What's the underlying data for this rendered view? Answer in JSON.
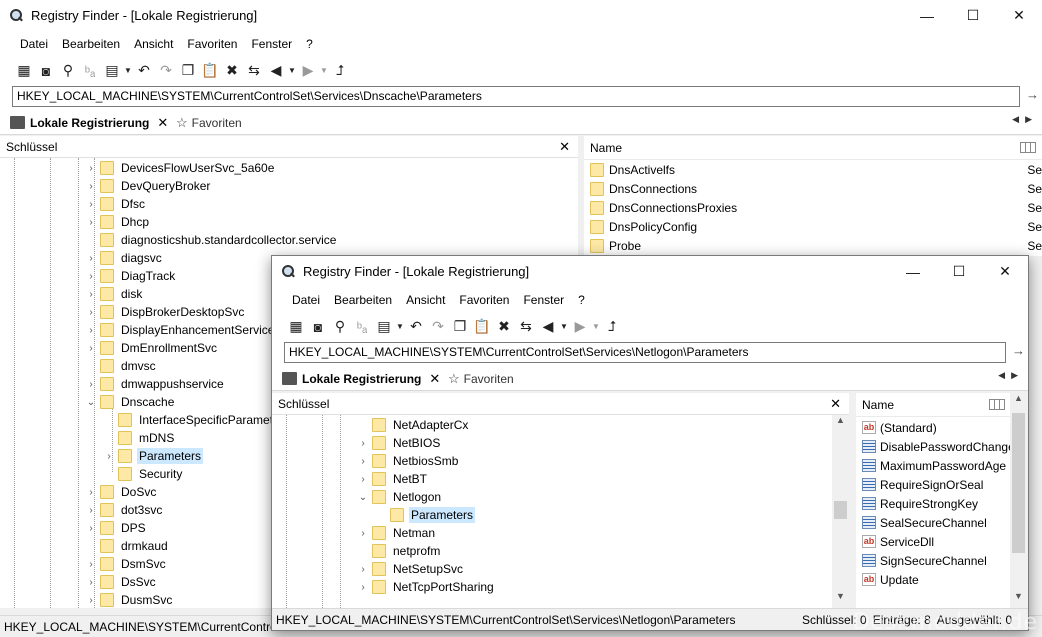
{
  "main": {
    "title": "Registry Finder - [Lokale Registrierung]",
    "menu": [
      "Datei",
      "Bearbeiten",
      "Ansicht",
      "Favoriten",
      "Fenster",
      "?"
    ],
    "address": "HKEY_LOCAL_MACHINE\\SYSTEM\\CurrentControlSet\\Services\\Dnscache\\Parameters",
    "tab_label": "Lokale Registrierung",
    "favorites_tab": "Favoriten",
    "keys_header": "Schlüssel",
    "name_header": "Name",
    "tree": [
      {
        "label": "DevicesFlowUserSvc_5a60e"
      },
      {
        "label": "DevQueryBroker"
      },
      {
        "label": "Dfsc"
      },
      {
        "label": "Dhcp"
      },
      {
        "label": "diagnosticshub.standardcollector.service"
      },
      {
        "label": "diagsvc"
      },
      {
        "label": "DiagTrack"
      },
      {
        "label": "disk"
      },
      {
        "label": "DispBrokerDesktopSvc"
      },
      {
        "label": "DisplayEnhancementService"
      },
      {
        "label": "DmEnrollmentSvc"
      },
      {
        "label": "dmvsc"
      },
      {
        "label": "dmwappushservice"
      },
      {
        "label": "Dnscache"
      },
      {
        "label": "InterfaceSpecificParameters"
      },
      {
        "label": "mDNS"
      },
      {
        "label": "Parameters"
      },
      {
        "label": "Security"
      },
      {
        "label": "DoSvc"
      },
      {
        "label": "dot3svc"
      },
      {
        "label": "DPS"
      },
      {
        "label": "drmkaud"
      },
      {
        "label": "DsmSvc"
      },
      {
        "label": "DsSvc"
      },
      {
        "label": "DusmSvc"
      }
    ],
    "list": [
      {
        "name": "DnsActivelfs",
        "tail": "Se"
      },
      {
        "name": "DnsConnections",
        "tail": "Se"
      },
      {
        "name": "DnsConnectionsProxies",
        "tail": "Se"
      },
      {
        "name": "DnsPolicyConfig",
        "tail": "Se"
      },
      {
        "name": "Probe",
        "tail": "Se"
      }
    ],
    "status": "HKEY_LOCAL_MACHINE\\SYSTEM\\CurrentControlSet"
  },
  "second": {
    "title": "Registry Finder - [Lokale Registrierung]",
    "menu": [
      "Datei",
      "Bearbeiten",
      "Ansicht",
      "Favoriten",
      "Fenster",
      "?"
    ],
    "address": "HKEY_LOCAL_MACHINE\\SYSTEM\\CurrentControlSet\\Services\\Netlogon\\Parameters",
    "tab_label": "Lokale Registrierung",
    "favorites_tab": "Favoriten",
    "keys_header": "Schlüssel",
    "name_header": "Name",
    "tree": [
      {
        "label": "NetAdapterCx"
      },
      {
        "label": "NetBIOS"
      },
      {
        "label": "NetbiosSmb"
      },
      {
        "label": "NetBT"
      },
      {
        "label": "Netlogon"
      },
      {
        "label": "Parameters"
      },
      {
        "label": "Netman"
      },
      {
        "label": "netprofm"
      },
      {
        "label": "NetSetupSvc"
      },
      {
        "label": "NetTcpPortSharing"
      }
    ],
    "values": [
      {
        "name": "(Standard)",
        "kind": "string"
      },
      {
        "name": "DisablePasswordChange",
        "kind": "dword"
      },
      {
        "name": "MaximumPasswordAge",
        "kind": "dword"
      },
      {
        "name": "RequireSignOrSeal",
        "kind": "dword"
      },
      {
        "name": "RequireStrongKey",
        "kind": "dword"
      },
      {
        "name": "SealSecureChannel",
        "kind": "dword"
      },
      {
        "name": "ServiceDll",
        "kind": "string"
      },
      {
        "name": "SignSecureChannel",
        "kind": "dword"
      },
      {
        "name": "Update",
        "kind": "string"
      }
    ],
    "status_path": "HKEY_LOCAL_MACHINE\\SYSTEM\\CurrentControlSet\\Services\\Netlogon\\Parameters",
    "status_keys": "Schlüssel: 0",
    "status_entries": "Einträge: 8",
    "status_selected": "Ausgewählt: 0"
  },
  "watermark": "Deskmodder.de"
}
